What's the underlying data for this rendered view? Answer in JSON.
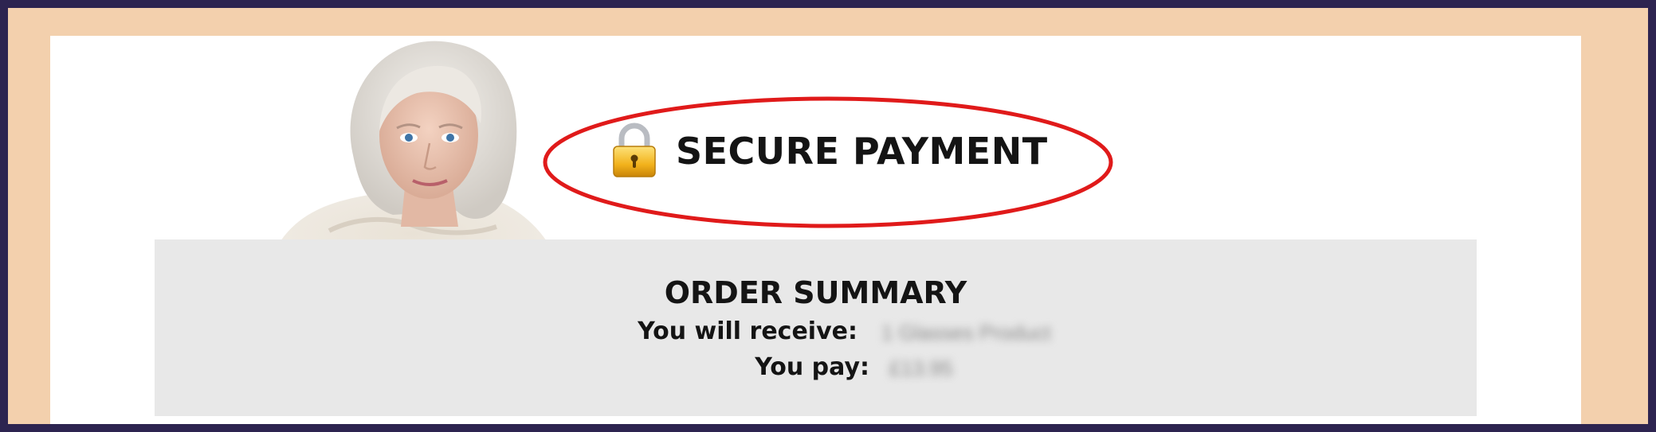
{
  "secure_banner": {
    "title": "SECURE PAYMENT",
    "icon": "lock-icon"
  },
  "order_summary": {
    "title": "ORDER SUMMARY",
    "receive_label": "You will receive:",
    "receive_value": "1 Glasses Product",
    "pay_label": "You pay:",
    "pay_value": "£13.95"
  },
  "colors": {
    "background_outer": "#2d2450",
    "frame": "#f3d0ad",
    "card": "#ffffff",
    "summary_panel": "#e8e8e8",
    "highlight_ellipse": "#e01a1a",
    "lock_gold": "#f2b21c"
  }
}
